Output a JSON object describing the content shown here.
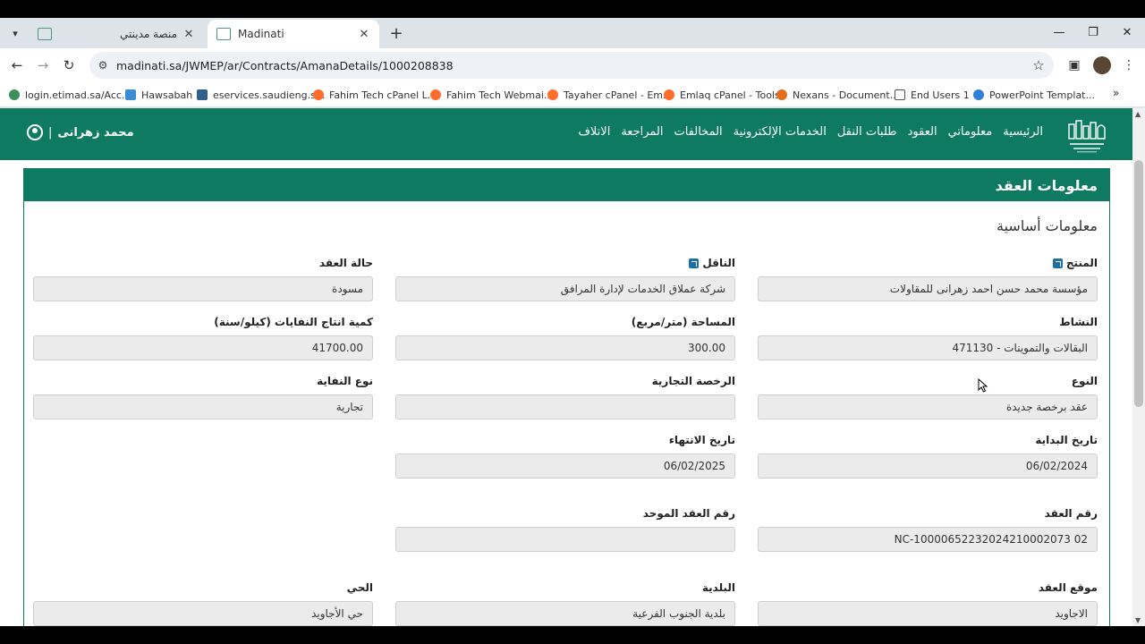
{
  "browser": {
    "tabs": [
      {
        "title": "منصة مدينتي",
        "active": false
      },
      {
        "title": "Madinati",
        "active": true
      }
    ],
    "url": "madinati.sa/JWMEP/ar/Contracts/AmanaDetails/1000208838",
    "bookmarks": [
      {
        "label": "login.etimad.sa/Acc...",
        "color": "#3a8f5b"
      },
      {
        "label": "Hawsabah",
        "color": "#3b8bd1"
      },
      {
        "label": "eservices.saudieng.s...",
        "color": "#2f5f8a"
      },
      {
        "label": "Fahim Tech cPanel L...",
        "color": "#ff6c2c"
      },
      {
        "label": "Fahim Tech Webmai...",
        "color": "#ff6c2c"
      },
      {
        "label": "Tayaher cPanel - Em...",
        "color": "#ff6c2c"
      },
      {
        "label": "Emlaq cPanel - Tools",
        "color": "#ff6c2c"
      },
      {
        "label": "Nexans - Document...",
        "color": "#e0701f"
      },
      {
        "label": "End Users 1",
        "color": "#555555"
      },
      {
        "label": "PowerPoint Templat...",
        "color": "#2f7fd6"
      }
    ]
  },
  "site": {
    "brand_color": "#0e7a62",
    "nav": [
      "الرئيسية",
      "معلوماتي",
      "العقود",
      "طلبات النقل",
      "الخدمات الإلكترونية",
      "المخالفات",
      "المراجعة",
      "الاتلاف"
    ],
    "user_name": "محمد زهرانى",
    "user_separator": "|"
  },
  "card": {
    "header": "معلومات العقد",
    "section_title": "معلومات أساسية",
    "fields": {
      "producer": {
        "label": "المنتج",
        "value": "مؤسسة محمد حسن احمد زهرانى للمقاولات"
      },
      "carrier": {
        "label": "الناقل",
        "value": "شركة عملاق الخدمات لإدارة المرافق"
      },
      "contract_status": {
        "label": "حالة العقد",
        "value": "مسودة"
      },
      "activity": {
        "label": "النشاط",
        "value": "471130  -  البقالات والتموينات"
      },
      "area": {
        "label": "المساحة (متر/مربع)",
        "value": "300.00"
      },
      "waste_qty": {
        "label": "كمية انتاج النفايات (كيلو/سنة)",
        "value": "41700.00"
      },
      "type": {
        "label": "النوع",
        "value": "عقد برخصة جديدة"
      },
      "commercial_license": {
        "label": "الرخصة التجارية",
        "value": ""
      },
      "waste_type": {
        "label": "نوع النفاية",
        "value": "تجارية"
      },
      "start_date": {
        "label": "تاريخ البداية",
        "value": "06/02/2024"
      },
      "end_date": {
        "label": "تاريخ الانتهاء",
        "value": "06/02/2025"
      },
      "contract_number": {
        "label": "رقم العقد",
        "value": "NC-10000652232024210002073 02"
      },
      "unified_number": {
        "label": "رقم العقد الموحد",
        "value": ""
      },
      "location": {
        "label": "موقع العقد",
        "value": "الاجاويد"
      },
      "municipality": {
        "label": "البلدية",
        "value": "بلدية الجنوب الفرعية"
      },
      "district": {
        "label": "الحي",
        "value": "حي الأجاويد"
      }
    }
  }
}
